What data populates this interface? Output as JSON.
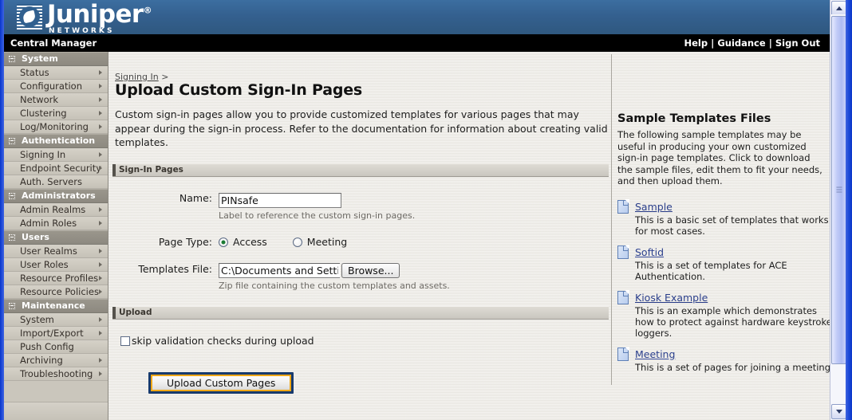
{
  "brand": {
    "name": "Juniper",
    "registered": "®",
    "sub": "NETWORKS"
  },
  "topbar": {
    "app_title": "Central Manager",
    "links": [
      {
        "label": "Help"
      },
      {
        "label": "Guidance"
      },
      {
        "label": "Sign Out"
      }
    ],
    "separator": "|"
  },
  "sidebar": {
    "groups": [
      {
        "label": "System",
        "items": [
          {
            "label": "Status",
            "chevron": true
          },
          {
            "label": "Configuration",
            "chevron": true
          },
          {
            "label": "Network",
            "chevron": true
          },
          {
            "label": "Clustering",
            "chevron": true
          },
          {
            "label": "Log/Monitoring",
            "chevron": true
          }
        ]
      },
      {
        "label": "Authentication",
        "items": [
          {
            "label": "Signing In",
            "chevron": true
          },
          {
            "label": "Endpoint Security",
            "chevron": true
          },
          {
            "label": "Auth. Servers",
            "chevron": false
          }
        ]
      },
      {
        "label": "Administrators",
        "items": [
          {
            "label": "Admin Realms",
            "chevron": true
          },
          {
            "label": "Admin Roles",
            "chevron": true
          }
        ]
      },
      {
        "label": "Users",
        "items": [
          {
            "label": "User Realms",
            "chevron": true
          },
          {
            "label": "User Roles",
            "chevron": true
          },
          {
            "label": "Resource Profiles",
            "chevron": true
          },
          {
            "label": "Resource Policies",
            "chevron": true
          }
        ]
      },
      {
        "label": "Maintenance",
        "items": [
          {
            "label": "System",
            "chevron": true
          },
          {
            "label": "Import/Export",
            "chevron": true
          },
          {
            "label": "Push Config",
            "chevron": false
          },
          {
            "label": "Archiving",
            "chevron": true
          },
          {
            "label": "Troubleshooting",
            "chevron": true
          }
        ]
      }
    ]
  },
  "main": {
    "breadcrumb_link": "Signing In",
    "breadcrumb_sep": ">",
    "title": "Upload Custom Sign-In Pages",
    "intro": "Custom sign-in pages allow you to provide customized templates for various pages that may appear during the sign-in process. Refer to the documentation for information about creating valid templates.",
    "sections": {
      "signin": {
        "header": "Sign-In Pages",
        "name_label": "Name:",
        "name_value": "PINsafe",
        "name_hint": "Label to reference the custom sign-in pages.",
        "pagetype_label": "Page Type:",
        "pagetype_options": [
          {
            "label": "Access",
            "selected": true
          },
          {
            "label": "Meeting",
            "selected": false
          }
        ],
        "templates_label": "Templates File:",
        "templates_value": "C:\\Documents and Settings",
        "browse_label": "Browse...",
        "templates_hint": "Zip file containing the custom templates and assets."
      },
      "upload": {
        "header": "Upload",
        "skip_label": "skip validation checks during upload",
        "skip_checked": false,
        "submit_label": "Upload Custom Pages"
      }
    }
  },
  "side_panel": {
    "title": "Sample Templates Files",
    "intro": "The following sample templates may be useful in producing your own customized sign-in page templates. Click to download the sample files, edit them to fit your needs, and then upload them.",
    "templates": [
      {
        "link": "Sample",
        "desc": "This is a basic set of templates that works for most cases."
      },
      {
        "link": "Softid",
        "desc": "This is a set of templates for ACE Authentication."
      },
      {
        "link": "Kiosk Example",
        "desc": "This is an example which demonstrates how to protect against hardware keystroke loggers."
      },
      {
        "link": "Meeting",
        "desc": "This is a set of pages for joining a meeting."
      }
    ]
  },
  "colors": {
    "banner_blue": "#34608f",
    "black_bar": "#000000",
    "nav_group": "#928e85",
    "nav_item": "#cdc9c0",
    "link_blue": "#2b3f8c",
    "button_gold": "#f0a818",
    "button_navy": "#173a6d",
    "radio_green": "#1a7a32",
    "frame_blue": "#1c49d8"
  }
}
